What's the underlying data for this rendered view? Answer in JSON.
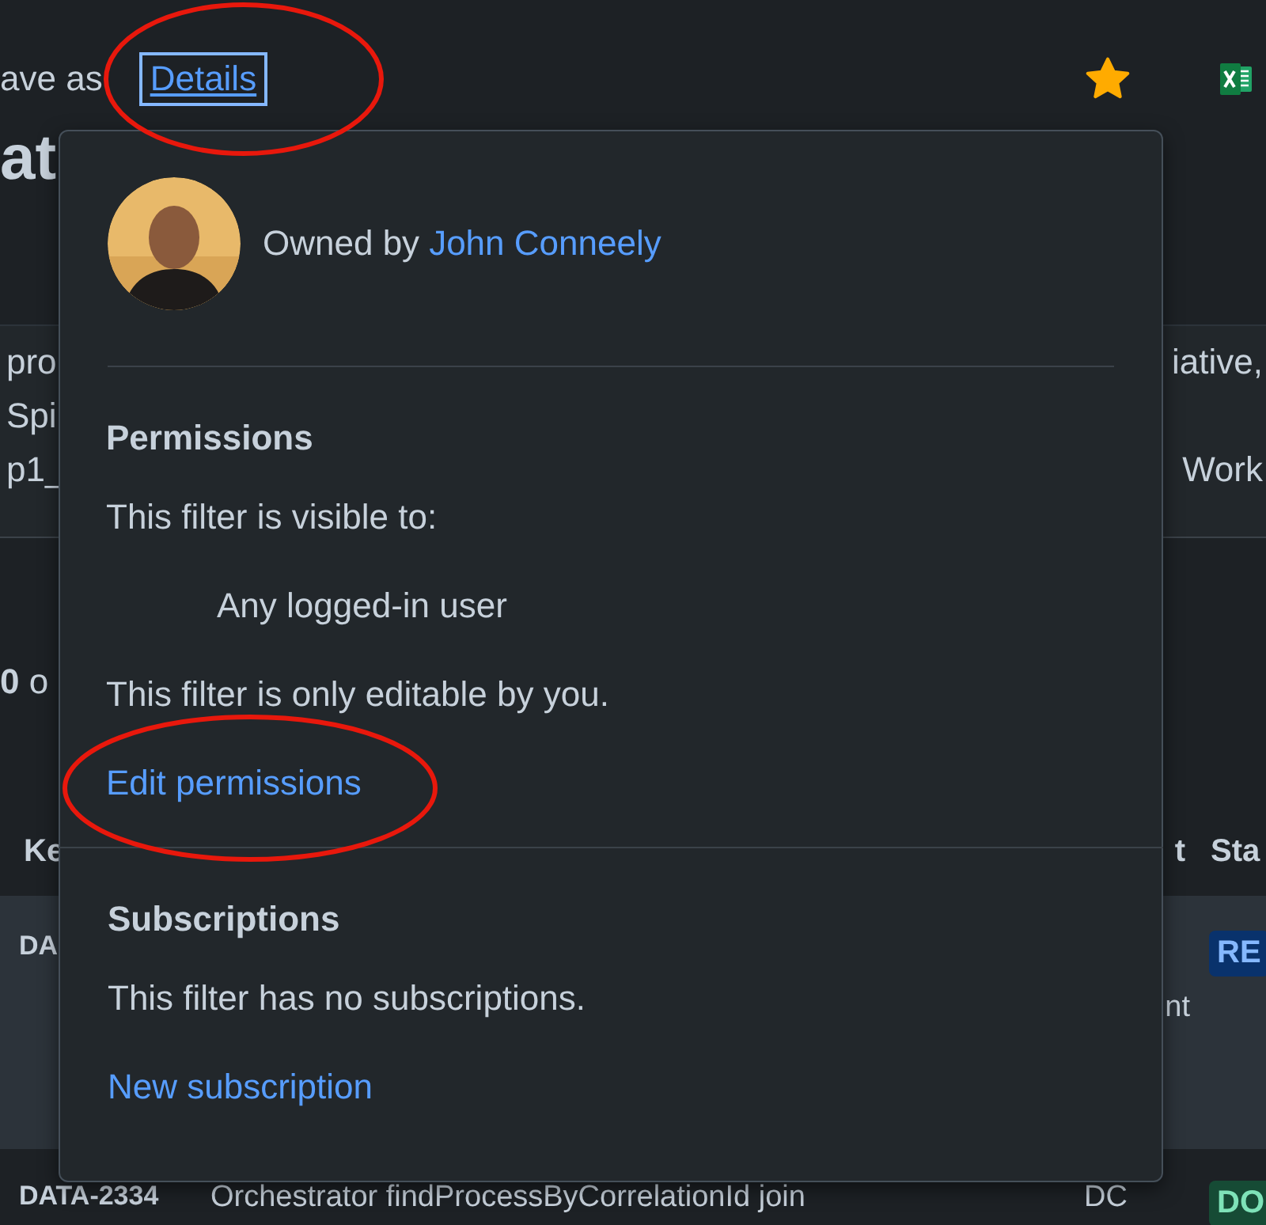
{
  "toolbar": {
    "save_as_label": "ave as",
    "details_link": "Details",
    "starred": true
  },
  "page_title": "at",
  "description": [
    {
      "left": "pro",
      "right": "iative,"
    },
    {
      "left": "Spi"
    },
    {
      "left": "p1_",
      "right": "Work"
    }
  ],
  "result_count": "**0** o",
  "table": {
    "columns": [
      "Ke",
      "t",
      "Sta"
    ],
    "rows": [
      {
        "key": "DA",
        "selected": true,
        "column_3": "nt",
        "status": {
          "label": "RE",
          "kind": "blue"
        }
      },
      {
        "key": "DATA-2334",
        "selected": false,
        "summary": "Orchestrator findProcessByCorrelationId join",
        "column_3": "DC",
        "status": {
          "label": "DO",
          "kind": "green"
        }
      }
    ]
  },
  "details_popup": {
    "owner_prefix": "Owned by",
    "owner_name": "John Conneely",
    "sections": [
      {
        "title": "Permissions",
        "items": [
          {
            "kind": "text",
            "text": "This filter is visible to:"
          },
          {
            "kind": "indented",
            "text": "Any logged-in user"
          },
          {
            "kind": "text",
            "text": "This filter is only editable by you."
          },
          {
            "kind": "link",
            "text": "Edit permissions"
          }
        ]
      },
      {
        "title": "Subscriptions",
        "items": [
          {
            "kind": "text",
            "text": "This filter has no subscriptions."
          },
          {
            "kind": "link",
            "text": "New subscription"
          }
        ]
      }
    ]
  }
}
